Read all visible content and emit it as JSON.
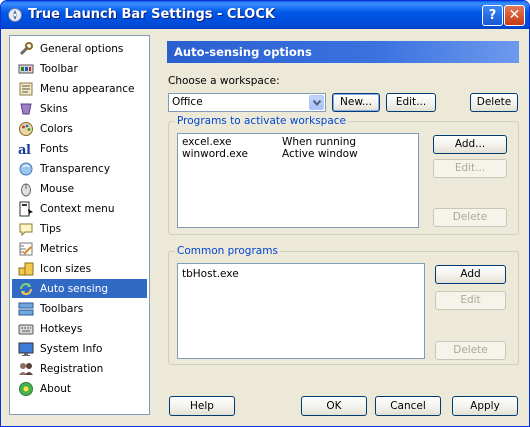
{
  "window": {
    "title": "True Launch Bar Settings - CLOCK",
    "help_glyph": "?",
    "close_glyph": "✕"
  },
  "sidebar": {
    "items": [
      {
        "label": "General options",
        "icon": "wrench-icon"
      },
      {
        "label": "Toolbar",
        "icon": "toolbar-icon"
      },
      {
        "label": "Menu appearance",
        "icon": "menu-icon"
      },
      {
        "label": "Skins",
        "icon": "skins-icon"
      },
      {
        "label": "Colors",
        "icon": "palette-icon"
      },
      {
        "label": "Fonts",
        "icon": "font-icon"
      },
      {
        "label": "Transparency",
        "icon": "transparency-icon"
      },
      {
        "label": "Mouse",
        "icon": "mouse-icon"
      },
      {
        "label": "Context menu",
        "icon": "context-menu-icon"
      },
      {
        "label": "Tips",
        "icon": "tips-icon"
      },
      {
        "label": "Metrics",
        "icon": "metrics-icon"
      },
      {
        "label": "Icon sizes",
        "icon": "icon-sizes-icon"
      },
      {
        "label": "Auto sensing",
        "icon": "auto-sensing-icon",
        "selected": true
      },
      {
        "label": "Toolbars",
        "icon": "toolbars-icon"
      },
      {
        "label": "Hotkeys",
        "icon": "keyboard-icon"
      },
      {
        "label": "System Info",
        "icon": "monitor-icon"
      },
      {
        "label": "Registration",
        "icon": "registration-icon"
      },
      {
        "label": "About",
        "icon": "about-icon"
      }
    ]
  },
  "main": {
    "header": "Auto-sensing options",
    "workspace_label": "Choose a workspace:",
    "workspace_value": "Office",
    "buttons": {
      "new": "New...",
      "edit": "Edit...",
      "delete": "Delete"
    },
    "programs_group": {
      "title": "Programs to activate workspace",
      "rows": [
        {
          "program": "excel.exe",
          "condition": "When running"
        },
        {
          "program": "winword.exe",
          "condition": "Active window"
        }
      ],
      "buttons": {
        "add": "Add...",
        "edit": "Edit...",
        "delete": "Delete"
      }
    },
    "common_group": {
      "title": "Common programs",
      "rows": [
        "tbHost.exe"
      ],
      "buttons": {
        "add": "Add",
        "edit": "Edit",
        "delete": "Delete"
      }
    }
  },
  "footer": {
    "help": "Help",
    "ok": "OK",
    "cancel": "Cancel",
    "apply": "Apply"
  },
  "colors": {
    "title_bar": "#0054E3",
    "selection": "#316AC5",
    "header_bar": "#2A5FD0",
    "group_title": "#0046D5"
  }
}
